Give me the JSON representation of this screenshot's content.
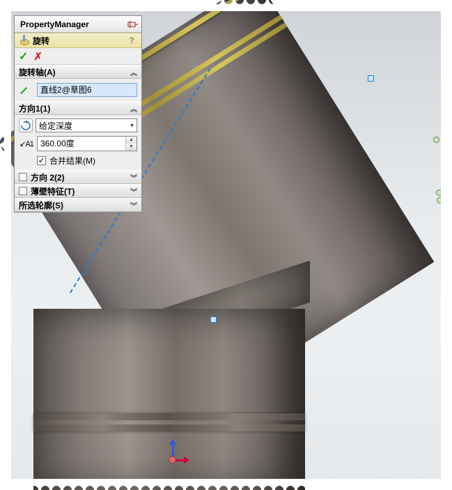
{
  "panel_title": "PropertyManager",
  "feature": {
    "name": "旋转"
  },
  "ok_cancel": {
    "ok": "✓",
    "cancel": "✗"
  },
  "axis_group": {
    "header": "旋转轴(A)",
    "selected": "直线2@草图6"
  },
  "dir1_group": {
    "header": "方向1(1)",
    "end_condition": "给定深度",
    "angle": "360.00度",
    "merge_label": "合并结果(M)",
    "merge_checked": true
  },
  "dir2_group": {
    "header": "方向 2(2)",
    "enabled": false
  },
  "thin_group": {
    "header": "薄壁特征(T)",
    "enabled": false
  },
  "contours_group": {
    "header": "所选轮廓(S)"
  },
  "help_symbol": "?",
  "chart_data": null
}
